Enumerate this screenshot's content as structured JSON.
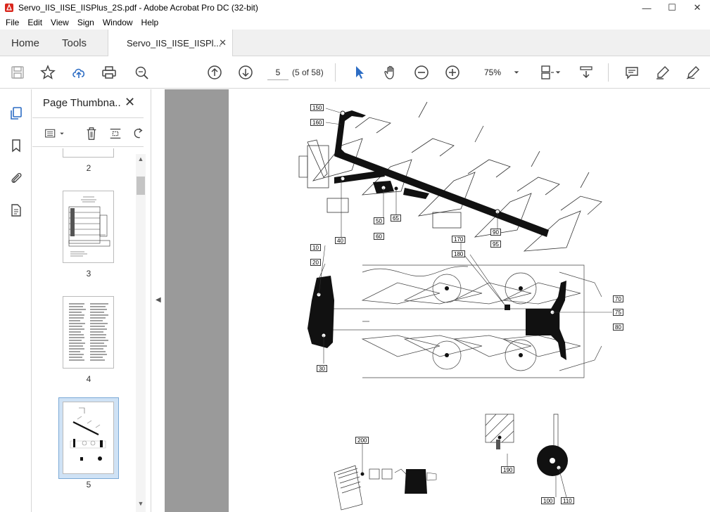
{
  "window": {
    "title": "Servo_IIS_IISE_IISPlus_2S.pdf - Adobe Acrobat Pro DC (32-bit)"
  },
  "menu": [
    "File",
    "Edit",
    "View",
    "Sign",
    "Window",
    "Help"
  ],
  "tabs": {
    "home": "Home",
    "tools": "Tools",
    "document": "Servo_IIS_IISE_IISPl..."
  },
  "toolbar": {
    "page_number": "5",
    "page_count": "(5 of 58)",
    "zoom": "75%"
  },
  "panel": {
    "title": "Page Thumbna...",
    "thumbnails": [
      {
        "label": "2"
      },
      {
        "label": "3"
      },
      {
        "label": "4"
      },
      {
        "label": "5"
      }
    ]
  },
  "drawing": {
    "callouts": [
      "150",
      "160",
      "40",
      "50",
      "60",
      "65",
      "170",
      "180",
      "90",
      "95",
      "10",
      "20",
      "30",
      "70",
      "75",
      "80",
      "200",
      "190",
      "100",
      "110"
    ]
  },
  "colors": {
    "accent": "#2d6dc4",
    "selection": "#cfe2f5",
    "doc_background": "#9a9a9a"
  }
}
